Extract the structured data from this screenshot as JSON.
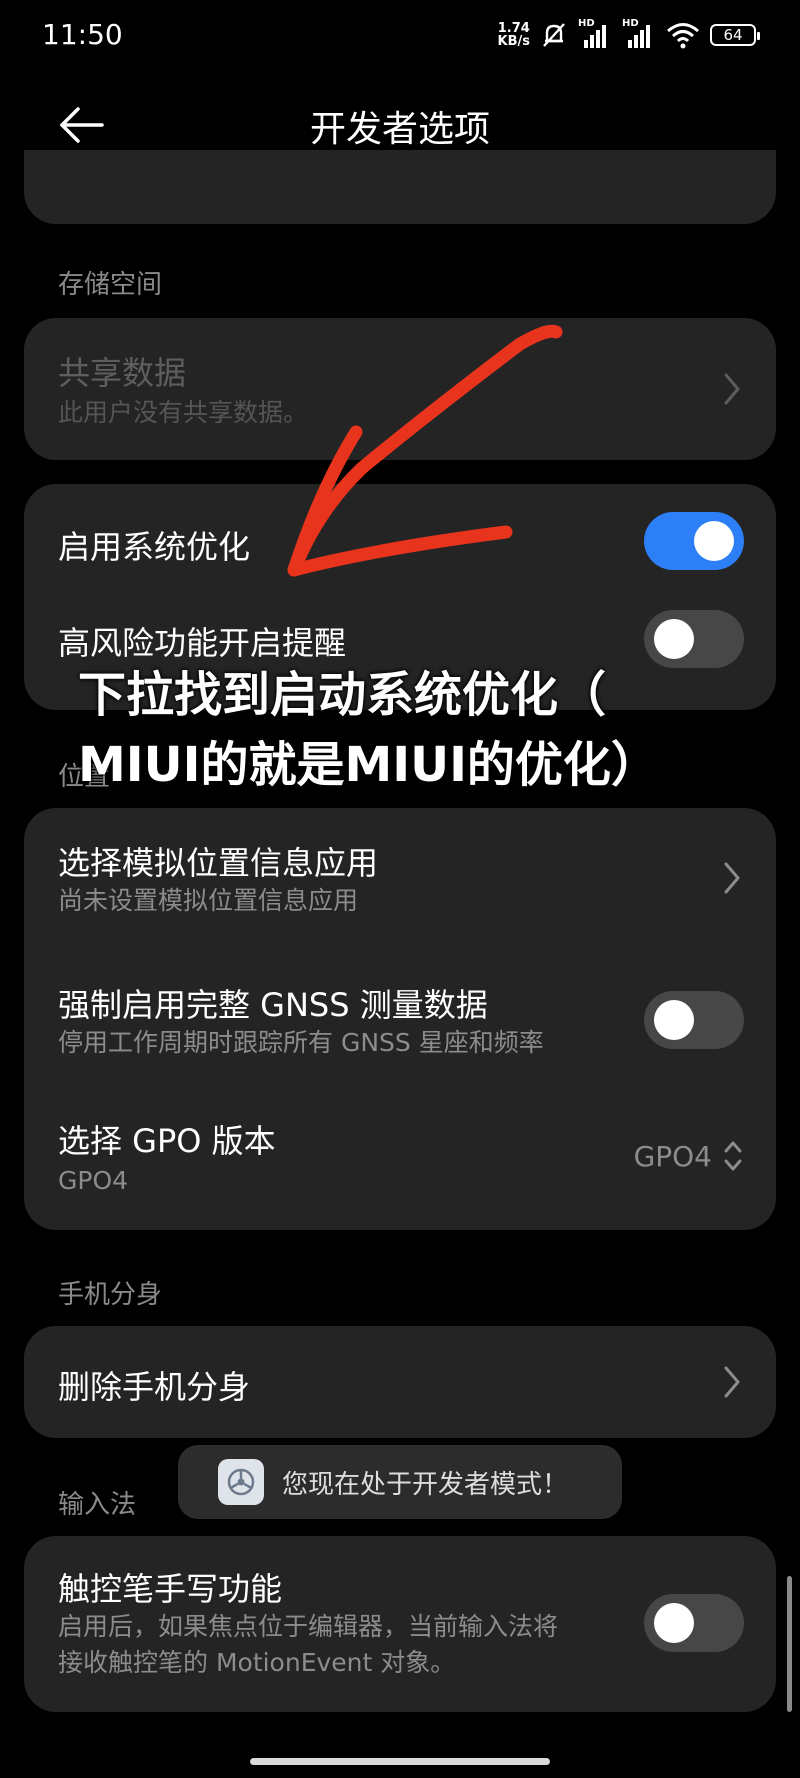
{
  "status_bar": {
    "time": "11:50",
    "net_speed_value": "1.74",
    "net_speed_unit": "KB/s",
    "signal_1_label": "HD",
    "signal_2_label": "HD",
    "battery": "64"
  },
  "header": {
    "title": "开发者选项"
  },
  "storage": {
    "section_label": "存储空间",
    "shared_data_title": "共享数据",
    "shared_data_sub": "此用户没有共享数据。"
  },
  "system": {
    "optimize_title": "启用系统优化",
    "optimize_on": true,
    "risk_title": "高风险功能开启提醒",
    "risk_on": false
  },
  "overlay": {
    "line1": "下拉找到启动系统优化（",
    "line2": "MIUI的就是MIUI的优化）"
  },
  "location": {
    "section_label": "位置",
    "mock_title": "选择模拟位置信息应用",
    "mock_sub": "尚未设置模拟位置信息应用",
    "gnss_title": "强制启用完整 GNSS 测量数据",
    "gnss_sub": "停用工作周期时跟踪所有 GNSS 星座和频率",
    "gnss_on": false,
    "gpo_title": "选择 GPO 版本",
    "gpo_sub": "GPO4",
    "gpo_value": "GPO4"
  },
  "clone": {
    "section_label": "手机分身",
    "delete_title": "删除手机分身"
  },
  "input": {
    "section_label": "输入法",
    "stylus_title": "触控笔手写功能",
    "stylus_sub1": "启用后，如果焦点位于编辑器，当前输入法将",
    "stylus_sub2": "接收触控笔的 MotionEvent 对象。",
    "stylus_on": false
  },
  "toast": {
    "text": "您现在处于开发者模式！"
  },
  "colors": {
    "accent": "#2c7ff6",
    "annotation_arrow": "#e8341c",
    "card_bg": "#242424"
  }
}
